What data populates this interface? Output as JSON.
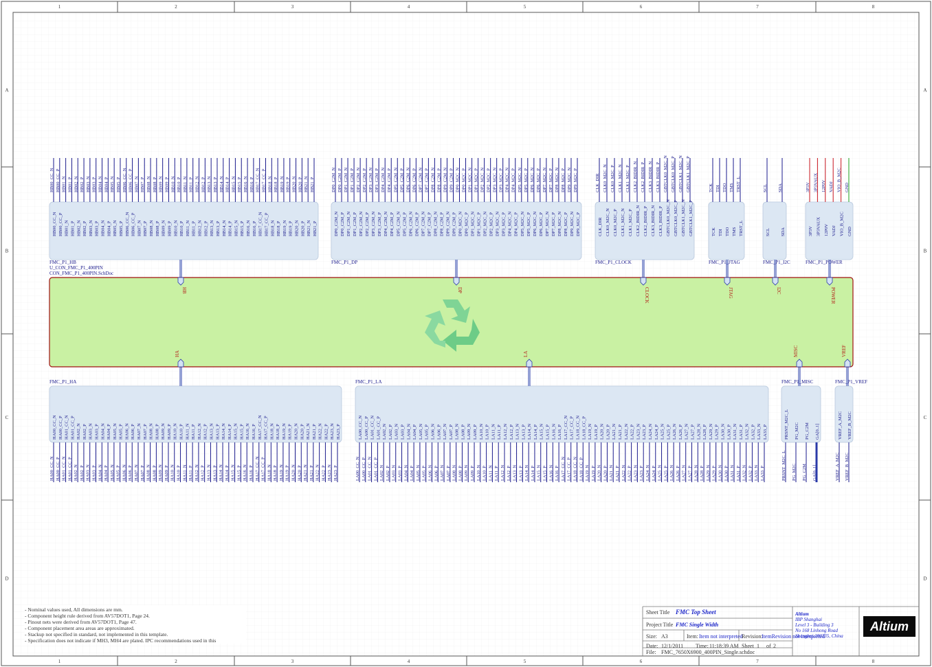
{
  "frame": {
    "cols": [
      "1",
      "2",
      "3",
      "4",
      "5",
      "6",
      "7",
      "8"
    ],
    "rows": [
      "A",
      "B",
      "C",
      "D"
    ]
  },
  "colors": {
    "wire": "#1a1a8c",
    "bus": "#2a3aa8",
    "power": "#c8141e",
    "ground": "#1ea01e",
    "harness_fill": "#dce7f3",
    "sheet_fill": "#c9f1a3",
    "sheet_border": "#a01010",
    "grid": "#e8e8e8",
    "text": "#1a1a8c"
  },
  "sheet_symbol": {
    "designator": "U_CON_FMC_P1_400PIN",
    "filename": "CON_FMC_P1_400PIN.SchDoc",
    "icon": "recycle-icon",
    "ports_top": [
      {
        "name": "HB",
        "harness": "FMC_P1_HB"
      },
      {
        "name": "DP",
        "harness": "FMC_P1_DP"
      },
      {
        "name": "CLOCK",
        "harness": "FMC_P1_CLOCK"
      },
      {
        "name": "JTAG",
        "harness": "FMC_P1_JTAG"
      },
      {
        "name": "I2C",
        "harness": "FMC_P1_I2C"
      },
      {
        "name": "POWER",
        "harness": "FMC_P1_POWER"
      }
    ],
    "ports_bottom": [
      {
        "name": "HA",
        "harness": "FMC_P1_HA"
      },
      {
        "name": "LA",
        "harness": "FMC_P1_LA"
      },
      {
        "name": "MISC",
        "harness": "FMC_P1_MISC"
      },
      {
        "name": "VREF",
        "harness": "FMC_P1_VREF"
      }
    ]
  },
  "harnesses": {
    "HB": {
      "label": "FMC_P1_HB",
      "signals": [
        "HB00_CC_N",
        "HB00_CC_P",
        "HB01_N",
        "HB01_P",
        "HB02_N",
        "HB02_P",
        "HB03_N",
        "HB03_P",
        "HB04_N",
        "HB04_P",
        "HB05_N",
        "HB05_P",
        "HB06_CC_N",
        "HB06_CC_P",
        "HB07_N",
        "HB07_P",
        "HB08_N",
        "HB08_P",
        "HB09_N",
        "HB09_P",
        "HB10_N",
        "HB10_P",
        "HB11_N",
        "HB11_P",
        "HB12_N",
        "HB12_P",
        "HB13_N",
        "HB13_P",
        "HB14_N",
        "HB14_P",
        "HB15_N",
        "HB15_P",
        "HB16_N",
        "HB16_P",
        "HB17_CC_N",
        "HB17_CC_P",
        "HB18_N",
        "HB18_P",
        "HB19_N",
        "HB19_P",
        "HB20_N",
        "HB20_P",
        "HB21_N",
        "HB21_P"
      ]
    },
    "DP": {
      "label": "FMC_P1_DP",
      "signals": [
        "DP0_C2M_N",
        "DP0_C2M_P",
        "DP1_C2M_N",
        "DP1_C2M_P",
        "DP2_C2M_N",
        "DP2_C2M_P",
        "DP3_C2M_N",
        "DP3_C2M_P",
        "DP4_C2M_N",
        "DP4_C2M_P",
        "DP5_C2M_N",
        "DP5_C2M_P",
        "DP6_C2M_N",
        "DP6_C2M_P",
        "DP7_C2M_N",
        "DP7_C2M_P",
        "DP8_C2M_N",
        "DP8_C2M_P",
        "DP9_C2M_N",
        "DP9_C2M_P",
        "DP0_M2C_N",
        "DP0_M2C_P",
        "DP1_M2C_N",
        "DP1_M2C_P",
        "DP2_M2C_N",
        "DP2_M2C_P",
        "DP3_M2C_N",
        "DP3_M2C_P",
        "DP4_M2C_N",
        "DP4_M2C_P",
        "DP5_M2C_N",
        "DP5_M2C_P",
        "DP6_M2C_N",
        "DP6_M2C_P",
        "DP7_M2C_N",
        "DP7_M2C_P",
        "DP8_M2C_N",
        "DP8_M2C_P",
        "DP9_M2C_N",
        "DP9_M2C_P"
      ]
    },
    "CLOCK": {
      "label": "FMC_P1_CLOCK",
      "signals": [
        "CLK_DIR",
        "CLK0_M2C_N",
        "CLK0_M2C_P",
        "CLK1_M2C_N",
        "CLK1_M2C_P",
        "CLK2_BIDIR_N",
        "CLK2_BIDIR_P",
        "CLK3_BIDIR_N",
        "CLK3_BIDIR_P",
        "GBTCLK0_M2C_N",
        "GBTCLK0_M2C_P",
        "GBTCLK1_M2C_N",
        "GBTCLK1_M2C_P"
      ]
    },
    "JTAG": {
      "label": "FMC_P1_JTAG",
      "signals": [
        "TCK",
        "TDI",
        "TDO",
        "TMS",
        "TRST_L"
      ]
    },
    "I2C": {
      "label": "FMC_P1_I2C",
      "signals": [
        "SCL",
        "SDA"
      ]
    },
    "POWER": {
      "label": "FMC_P1_POWER",
      "signals": [
        "3P3V",
        "3P3VAUX",
        "12P0V",
        "VADJ",
        "VIO_B_M2C",
        "GND"
      ]
    },
    "HA": {
      "label": "FMC_P1_HA",
      "signals": [
        "HA00_CC_N",
        "HA00_CC_P",
        "HA01_CC_N",
        "HA01_CC_P",
        "HA02_N",
        "HA02_P",
        "HA03_N",
        "HA03_P",
        "HA04_N",
        "HA04_P",
        "HA05_N",
        "HA05_P",
        "HA06_N",
        "HA06_P",
        "HA07_N",
        "HA07_P",
        "HA08_N",
        "HA08_P",
        "HA09_N",
        "HA09_P",
        "HA10_N",
        "HA10_P",
        "HA11_N",
        "HA11_P",
        "HA12_N",
        "HA12_P",
        "HA13_N",
        "HA13_P",
        "HA14_N",
        "HA14_P",
        "HA15_N",
        "HA15_P",
        "HA16_N",
        "HA16_P",
        "HA17_CC_N",
        "HA17_CC_P",
        "HA18_N",
        "HA18_P",
        "HA19_N",
        "HA19_P",
        "HA20_N",
        "HA20_P",
        "HA21_N",
        "HA21_P",
        "HA22_N",
        "HA22_P",
        "HA23_N",
        "HA23_P"
      ]
    },
    "LA": {
      "label": "FMC_P1_LA",
      "signals": [
        "LA00_CC_N",
        "LA00_CC_P",
        "LA01_CC_N",
        "LA01_CC_P",
        "LA02_N",
        "LA02_P",
        "LA03_N",
        "LA03_P",
        "LA04_N",
        "LA04_P",
        "LA05_N",
        "LA05_P",
        "LA06_N",
        "LA06_P",
        "LA07_N",
        "LA07_P",
        "LA08_N",
        "LA08_P",
        "LA09_N",
        "LA09_P",
        "LA10_N",
        "LA10_P",
        "LA11_N",
        "LA11_P",
        "LA12_N",
        "LA12_P",
        "LA13_N",
        "LA13_P",
        "LA14_N",
        "LA14_P",
        "LA15_N",
        "LA15_P",
        "LA16_N",
        "LA16_P",
        "LA17_CC_N",
        "LA17_CC_P",
        "LA18_CC_N",
        "LA18_CC_P",
        "LA19_N",
        "LA19_P",
        "LA20_N",
        "LA20_P",
        "LA21_N",
        "LA21_P",
        "LA22_N",
        "LA22_P",
        "LA23_N",
        "LA23_P",
        "LA24_N",
        "LA24_P",
        "LA25_N",
        "LA25_P",
        "LA26_N",
        "LA26_P",
        "LA27_N",
        "LA27_P",
        "LA28_N",
        "LA28_P",
        "LA29_N",
        "LA29_P",
        "LA30_N",
        "LA30_P",
        "LA31_N",
        "LA31_P",
        "LA32_N",
        "LA32_P",
        "LA33_N",
        "LA33_P"
      ]
    },
    "MISC": {
      "label": "FMC_P1_MISC",
      "signals": [
        "PRSNT_M2C_L",
        "PG_M2C",
        "PG_C2M",
        "GA[0..1]"
      ]
    },
    "VREF": {
      "label": "FMC_P1_VREF",
      "signals": [
        "VREF_A_M2C",
        "VREF_B_M2C"
      ]
    }
  },
  "notes": [
    "- Nominal values used, All dimensions are mm.",
    "- Component height rule derived from AV57DOT1, Page 24.",
    "- Pinout nets were derived from  AV57DOT1, Page 47.",
    "- Component placement area areas are approximated.",
    "- Stackup not specified in standard, not implemented in this template.",
    "- Specification does not indicate if MH3, MH4 are plated. IPC recommendations used in this"
  ],
  "title_block": {
    "sheet_title_label": "Sheet Title",
    "sheet_title": "FMC Top Sheet",
    "project_title_label": "Project Title",
    "project_title": "FMC Single Width",
    "size_label": "Size:",
    "size": "A3",
    "item_label": "Item:",
    "item": "Item not interpreted",
    "revision_label": "Revision:",
    "revision": "ItemRevision not interpreted",
    "date_label": "Date:",
    "date": "12/1/2011",
    "time_label": "Time:",
    "time": "11:18:39 AM",
    "sheet_label": "Sheet",
    "sheet_no": "1",
    "of_label": "of",
    "sheet_total": "2",
    "file_label": "File:",
    "file": "FMC_7650X6900_400PIN_Single.schdoc",
    "company_lines": [
      "Altium",
      "IBP Shanghai",
      "Level 3 - Building 3",
      "No 168 Linhong Road",
      "Shanghai 200335, China"
    ],
    "logo_text": "Altium"
  }
}
